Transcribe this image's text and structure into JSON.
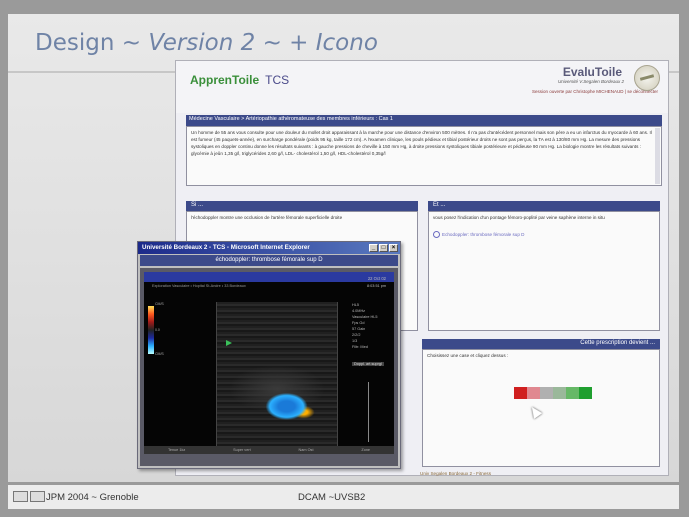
{
  "slide": {
    "title_main": "Design ~ ",
    "title_italic": "Version 2 ~ + Icono"
  },
  "app": {
    "logo_left": "ApprenToile",
    "logo_tcs": "TCS",
    "logo_right": "EvaluToile",
    "university": "Université V.Segalen Bordeaux 2",
    "session": "Session ouverte par Christophe MICHENAUD | se déconnecter",
    "case_title": "Médecine Vasculaire > Artériopathie athéromateuse des membres inférieurs : Cas 1",
    "case_text": "Un homme de 55 ans vous consulte pour une douleur du mollet droit apparaissant à la marche pour une distance d'environ 500 mètres. Il n'a pas d'antécédent personnel mais son père a eu un infarctus du myocarde à 60 ans. Il est fumeur (45 paquets-année), en surcharge pondérale (poids 95 kg, taille 172 cm). A l'examen clinique, les pouls pédieux et tibial postérieur droits ne sont pas perçus, la TA est à 130/80 mm Hg. La mesure des pressions systoliques en doppler continu donne les résultats suivants : à gauche pressions de cheville à 150 mm Hg, à droite pressions systoliques tibiale postérieure et pédieuse 90 mm Hg. La biologie montre les résultats suivants : glycémie à jeûn 1,35 g/l, triglycérides 2,60 g/l, LDL- cholestérol 1,50 g/l, HDL-cholestérol 0,35g/l",
    "si_head": "Si ...",
    "si_text": "l'échodoppler montre une occlusion de l'artère fémorale superficielle droite",
    "et_head": "Et ...",
    "et_text": "vous posez l'indication d'un pontage fémoro-poplité par veine saphène interne in situ",
    "et_link": "Echodoppler: thrombose fémorale sup D",
    "prescr_head": "Cette prescription devient ...",
    "prescr_text": "Choisissez une case et cliquez dessus :",
    "footer": "Univ Segalen Bordeaux 2 - Fitness",
    "colors": [
      "#d01f1f",
      "#e08890",
      "#b0b0b0",
      "#9ab89a",
      "#66b866",
      "#1f9f2f"
    ]
  },
  "popup": {
    "title": "Université Bordeaux 2 - TCS - Microsoft Internet Explorer",
    "subtitle": "échodoppler: thrombose fémorale sup D",
    "us_hdr": "Exploration Vasculaire • Hopital St-Andre • 33 Bordeaux",
    "us_date": "22 Oct 02",
    "us_time": "8:03:51 pm",
    "scale_top": "CM/S",
    "scale_mid": "0.0",
    "scale_bot": "CM/S",
    "params": [
      "HL5",
      "4.0MHz",
      "Vasculaire HL5",
      "Fps Gd",
      "",
      "57 Gain",
      "2/2/2",
      "1/3",
      "Filtr: Med",
      "Gain ECG"
    ],
    "us_button": "Doppl. art.suprgl",
    "bottom_labels": [
      "Tenue 1kz",
      "Super vert",
      "Nam Ost",
      "Zone"
    ],
    "btn_min": "_",
    "btn_max": "□",
    "btn_close": "×"
  },
  "bottom": {
    "left": "JPM 2004 ~ Grenoble",
    "center": "DCAM ~UVSB2"
  }
}
